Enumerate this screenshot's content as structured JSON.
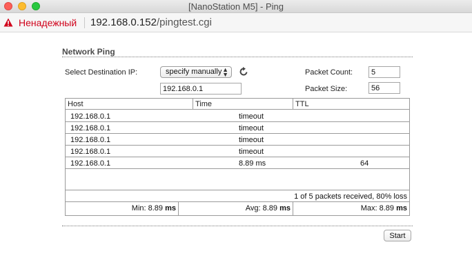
{
  "window": {
    "title": "[NanoStation M5] - Ping"
  },
  "urlbar": {
    "security_label": "Ненадежный",
    "url_host": "192.168.0.152",
    "url_path": "/pingtest.cgi"
  },
  "page": {
    "section_title": "Network Ping",
    "dest_ip_label": "Select Destination IP:",
    "dest_select_value": "specify manually",
    "dest_ip_value": "192.168.0.1",
    "packet_count_label": "Packet Count:",
    "packet_count_value": "5",
    "packet_size_label": "Packet Size:",
    "packet_size_value": "56",
    "start_label": "Start"
  },
  "table": {
    "headers": [
      "Host",
      "Time",
      "TTL"
    ],
    "rows": [
      {
        "host": "192.168.0.1",
        "time": "timeout",
        "ttl": ""
      },
      {
        "host": "192.168.0.1",
        "time": "timeout",
        "ttl": ""
      },
      {
        "host": "192.168.0.1",
        "time": "timeout",
        "ttl": ""
      },
      {
        "host": "192.168.0.1",
        "time": "timeout",
        "ttl": ""
      },
      {
        "host": "192.168.0.1",
        "time": "8.89 ms",
        "ttl": "64"
      }
    ],
    "summary": "1 of 5 packets received, 80% loss",
    "min_label": "Min: 8.89",
    "avg_label": "Avg: 8.89",
    "max_label": "Max: 8.89",
    "unit": "ms"
  },
  "icons": {
    "warning": "warning-triangle-icon",
    "refresh": "refresh-icon",
    "select_arrows": "updown-arrows-icon"
  },
  "colors": {
    "insecure_text": "#d0021b",
    "traffic_close": "#fc5f57",
    "traffic_min": "#fdbc2e",
    "traffic_max": "#28c840"
  }
}
